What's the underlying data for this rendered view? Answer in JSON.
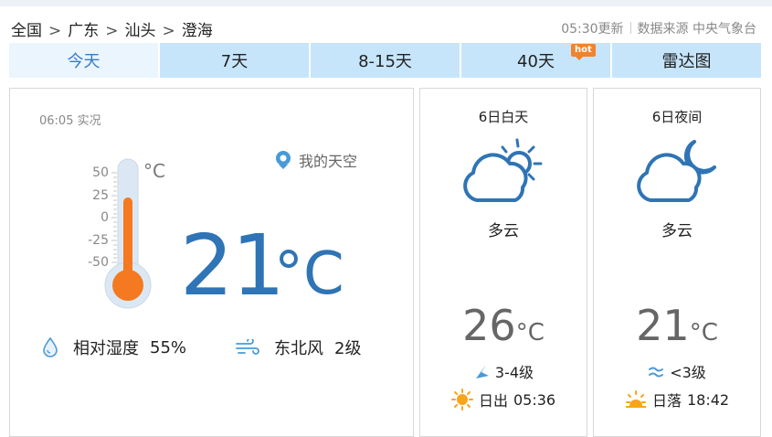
{
  "breadcrumb": {
    "items": [
      "全国",
      "广东",
      "汕头",
      "澄海"
    ],
    "sep": ">"
  },
  "meta": {
    "updated": "05:30更新",
    "source": "数据来源 中央气象台"
  },
  "tabs": [
    {
      "label": "今天",
      "active": true
    },
    {
      "label": "7天"
    },
    {
      "label": "8-15天"
    },
    {
      "label": "40天",
      "badge": "hot"
    },
    {
      "label": "雷达图"
    }
  ],
  "current": {
    "obs_time": "06:05 实况",
    "my_sky": "我的天空",
    "thermo_unit": "°C",
    "scale": [
      "50",
      "25",
      "0",
      "-25",
      "-50"
    ],
    "temp": "21",
    "unit": "°C",
    "humidity_label": "相对湿度",
    "humidity": "55%",
    "wind_dir": "东北风",
    "wind_level": "2级"
  },
  "day": {
    "title": "6日白天",
    "condition": "多云",
    "icon": "partly-cloudy-day-icon",
    "temp": "26",
    "unit": "°C",
    "wind": "3-4级",
    "sun_label": "日出",
    "sun_time": "05:36"
  },
  "night": {
    "title": "6日夜间",
    "condition": "多云",
    "icon": "partly-cloudy-night-icon",
    "temp": "21",
    "unit": "°C",
    "wind": "<3级",
    "sun_label": "日落",
    "sun_time": "18:42"
  },
  "colors": {
    "accent": "#2f74b5",
    "tab": "#c6e5fb",
    "tab_active": "#eaf5fe",
    "thermo": "#f47920",
    "hot": "#f0832d",
    "sun": "#f8a51c"
  }
}
